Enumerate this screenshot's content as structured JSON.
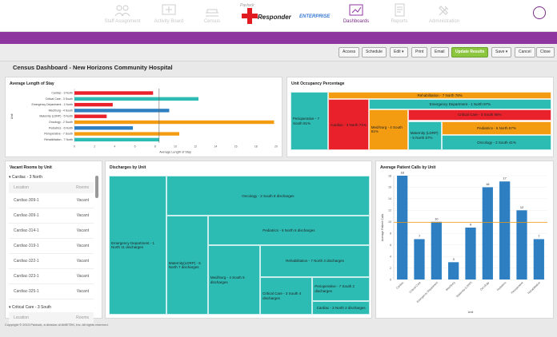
{
  "nav": {
    "items": [
      {
        "label": "Staff Assignment",
        "icon": "staff-icon"
      },
      {
        "label": "Activity Board",
        "icon": "board-icon"
      },
      {
        "label": "Census",
        "icon": "census-icon"
      },
      {
        "label": "Dashboards",
        "icon": "dashboard-icon"
      },
      {
        "label": "Reports",
        "icon": "reports-icon"
      },
      {
        "label": "Administration",
        "icon": "admin-icon"
      }
    ],
    "logo": {
      "line1": "Pavlock",
      "line2": "Responder",
      "line3": "ENTERPRISE"
    }
  },
  "toolbar": {
    "access": "Access",
    "schedule": "Schedule",
    "edit": "Edit ▾",
    "print": "Print",
    "email": "Email",
    "update": "Update Results",
    "save": "Save ▾",
    "cancel": "Cancel",
    "close": "Close"
  },
  "page_title": "Census Dashboard - New Horizons Community Hospital",
  "colors": {
    "teal": "#2cbcb4",
    "red": "#e8212b",
    "orange": "#f39c12",
    "blue": "#2e7fc1",
    "purple": "#8f35a0",
    "green": "#8cc63f"
  },
  "alos": {
    "title": "Average Length of Stay",
    "xlabel": "Average Length of Stay",
    "ylabel": "Unit",
    "chart_data": {
      "type": "bar",
      "orientation": "horizontal",
      "categories": [
        "Cardiac - 3 North",
        "Critical Care - 3 South",
        "Emergency Department - 1 North",
        "Med/Surg - 4 South",
        "Maternity (LDRP) - 5 North",
        "Oncology - 2 South",
        "Pediatrics - 6 North",
        "Perioperative - 7 South",
        "Rehabilitation - 7 North"
      ],
      "values": [
        7.8,
        12.3,
        3.8,
        9.4,
        3.2,
        19.8,
        5.8,
        10.4,
        8.4
      ],
      "bar_colors": [
        "#e8212b",
        "#2cbcb4",
        "#e8212b",
        "#2e7fc1",
        "#e8212b",
        "#f39c12",
        "#2e7fc1",
        "#f39c12",
        "#2cbcb4"
      ],
      "xlim": [
        0,
        20
      ],
      "xticks": [
        "0",
        "2",
        "4",
        "6",
        "8",
        "10",
        "12",
        "14",
        "16",
        "18",
        "20"
      ],
      "reference_line": 8.4
    }
  },
  "occupancy": {
    "title": "Unit Occupancy Percentage",
    "chart_data": {
      "type": "treemap",
      "items": [
        {
          "label": "Perioperative - 7 South 81%",
          "value": 81,
          "color": "#2cbcb4"
        },
        {
          "label": "Cardiac - 3 North 71%",
          "value": 71,
          "color": "#e8212b"
        },
        {
          "label": "Med/Surg - 4 South 61%",
          "value": 61,
          "color": "#f39c12"
        },
        {
          "label": "Maternity (LDRP) - 5 North 57%",
          "value": 57,
          "color": "#2cbcb4"
        },
        {
          "label": "Rehabilitation - 7 North 78%",
          "value": 78,
          "color": "#f39c12"
        },
        {
          "label": "Emergency Department - 1 North 97%",
          "value": 97,
          "color": "#2cbcb4"
        },
        {
          "label": "Critical Care - 3 South 66%",
          "value": 66,
          "color": "#e8212b"
        },
        {
          "label": "Pediatrics - 6 North 57%",
          "value": 57,
          "color": "#f39c12"
        },
        {
          "label": "Oncology - 2 South 41%",
          "value": 41,
          "color": "#2cbcb4"
        }
      ]
    }
  },
  "vacant": {
    "title": "Vacant Rooms by Unit",
    "groups": [
      {
        "name": "Cardiac - 3 North",
        "col_location": "Location",
        "col_rooms": "Rooms",
        "rows": [
          {
            "location": "Cardiac-309-1",
            "status": "Vacant"
          },
          {
            "location": "Cardiac-309-1",
            "status": "Vacant"
          },
          {
            "location": "Cardiac-314-1",
            "status": "Vacant"
          },
          {
            "location": "Cardiac-319-1",
            "status": "Vacant"
          },
          {
            "location": "Cardiac-322-1",
            "status": "Vacant"
          },
          {
            "location": "Cardiac-323-1",
            "status": "Vacant"
          },
          {
            "location": "Cardiac-325-1",
            "status": "Vacant"
          }
        ]
      },
      {
        "name": "Critical Care - 3 South",
        "col_location": "Location",
        "col_rooms": "Rooms",
        "rows": []
      }
    ]
  },
  "discharges": {
    "title": "Discharges by Unit",
    "chart_data": {
      "type": "treemap",
      "items": [
        {
          "label": "Emergency Department - 1 North 11 discharges",
          "value": 11
        },
        {
          "label": "Oncology - 2 South 8 discharges",
          "value": 8
        },
        {
          "label": "Pediatrics - 6 North 6 discharges",
          "value": 6
        },
        {
          "label": "Rehabilitation - 7 North 3 discharges",
          "value": 3
        },
        {
          "label": "Maternity(LDRP) - 5 North 7 discharges",
          "value": 7
        },
        {
          "label": "Med/Surg - 4 South 5 discharges",
          "value": 5
        },
        {
          "label": "Critical Care - 3 South 4 discharges",
          "value": 4
        },
        {
          "label": "Perioperative - 7 South 2 discharges",
          "value": 2
        },
        {
          "label": "Cardiac - 3 North 2 discharges",
          "value": 2
        }
      ],
      "color": "#2cbcb4"
    }
  },
  "calls": {
    "title": "Average Patient Calls by Unit",
    "xlabel": "Unit",
    "ylabel": "Average Patient Calls",
    "chart_data": {
      "type": "bar",
      "categories": [
        "Cardiac",
        "Critical Care",
        "Emergency Department",
        "Med/Surg",
        "Maternity (LDRP)",
        "Oncology",
        "Pediatrics",
        "Perioperative",
        "Rehabilitation"
      ],
      "values": [
        18,
        7,
        10,
        3,
        9,
        16,
        17,
        12,
        7
      ],
      "ylim": [
        0,
        18
      ],
      "yticks": [
        "0",
        "2",
        "4",
        "6",
        "8",
        "10",
        "12",
        "14",
        "16",
        "18"
      ],
      "reference_line": 9.9
    }
  },
  "footer": "Copyright © 2013 Pavlock, a division of AMETEK, Inc. All rights reserved."
}
